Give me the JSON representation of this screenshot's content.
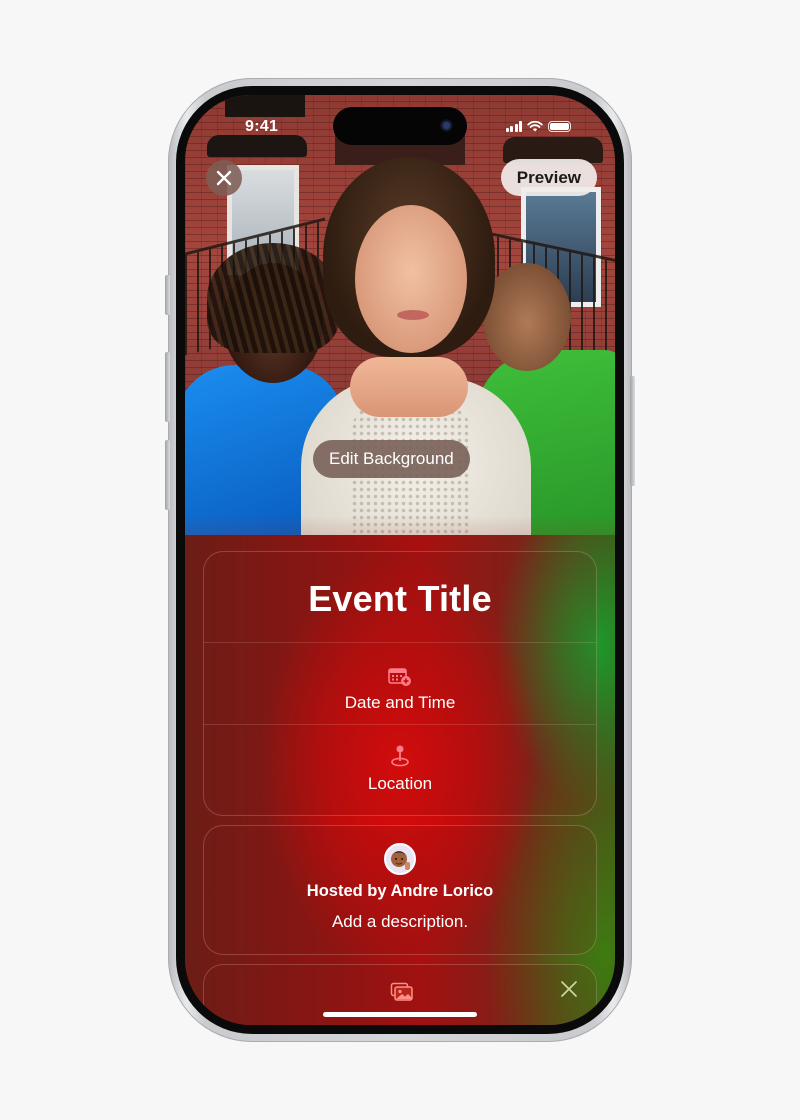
{
  "status_bar": {
    "time": "9:41",
    "icons": [
      "cellular-signal-icon",
      "wifi-icon",
      "battery-icon"
    ]
  },
  "top_controls": {
    "close_icon": "close-icon",
    "preview_label": "Preview"
  },
  "edit_background_label": "Edit Background",
  "event_card": {
    "title": "Event Title",
    "fields": [
      {
        "icon": "calendar-add-icon",
        "label": "Date and Time"
      },
      {
        "icon": "location-pin-icon",
        "label": "Location"
      }
    ]
  },
  "host_card": {
    "avatar_icon": "memoji-avatar-icon",
    "host_label": "Hosted by Andre Lorico",
    "description_placeholder": "Add a description."
  },
  "photos_card": {
    "icon": "photo-album-icon",
    "dismiss_icon": "close-icon"
  },
  "colors": {
    "accent_red": "#e10a0a",
    "icon_pink": "#ff7d8a",
    "dismiss_green": "#c7d9a0"
  }
}
